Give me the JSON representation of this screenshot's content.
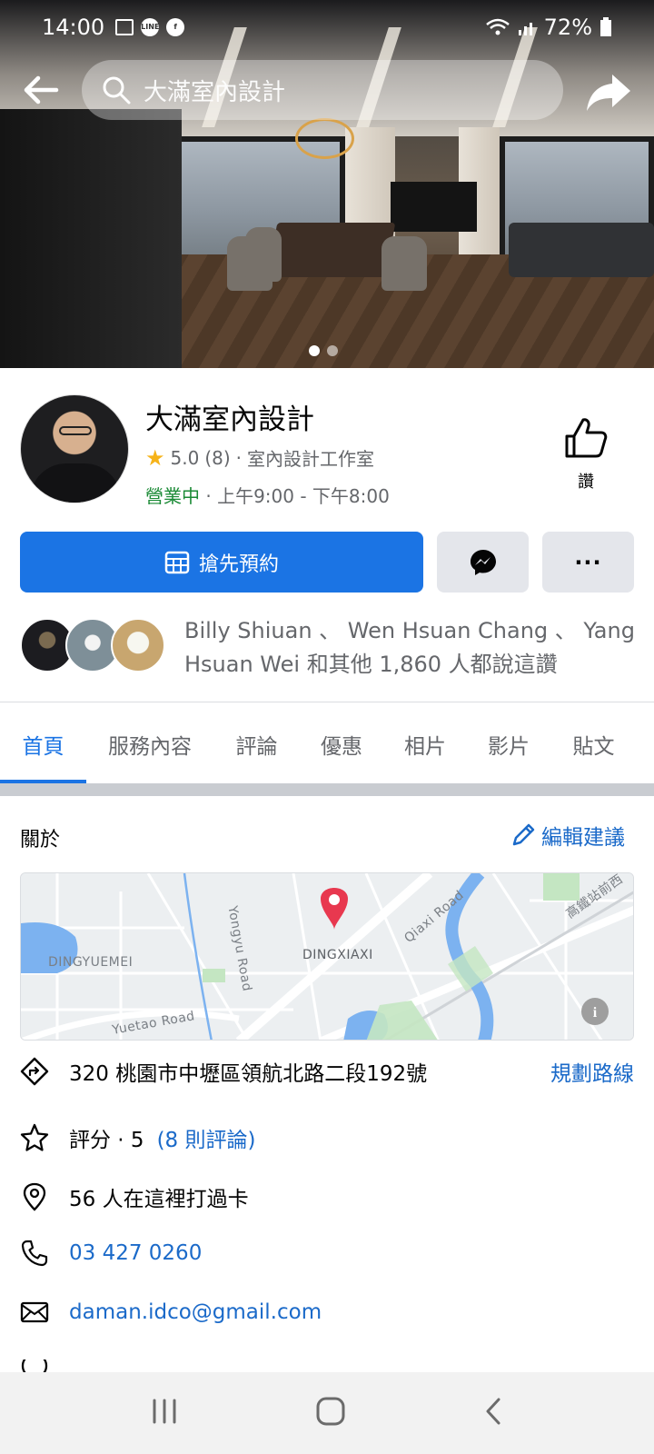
{
  "status_bar": {
    "time": "14:00",
    "battery": "72%"
  },
  "search": {
    "query": "大滿室內設計"
  },
  "page": {
    "name": "大滿室內設計",
    "rating_value": "5.0",
    "rating_count": "(8)",
    "separator": "·",
    "category": "室內設計工作室",
    "open_status": "營業中",
    "hours": "上午9:00 - 下午8:00",
    "like_label": "讚"
  },
  "actions": {
    "book_label": "搶先預約",
    "more_label": "···"
  },
  "friends_like": {
    "text": "Billy Shiuan 、 Wen Hsuan Chang 、 Yang Hsuan Wei 和其他 1,860 人都說這讚"
  },
  "tabs": [
    {
      "label": "首頁",
      "active": true
    },
    {
      "label": "服務內容",
      "active": false
    },
    {
      "label": "評論",
      "active": false
    },
    {
      "label": "優惠",
      "active": false
    },
    {
      "label": "相片",
      "active": false
    },
    {
      "label": "影片",
      "active": false
    },
    {
      "label": "貼文",
      "active": false
    }
  ],
  "about": {
    "heading": "關於",
    "edit_label": "編輯建議",
    "map_labels": {
      "center": "DINGXIAXI",
      "left": "DINGYUEMEI",
      "road1": "Yongyu Road",
      "road2": "Qiaxi Road",
      "road3": "Yuetao Road",
      "road4": "高鐵站前西"
    },
    "address": "320 桃園市中壢區領航北路二段192號",
    "directions_label": "規劃路線",
    "rating_prefix": "評分 · 5",
    "rating_reviews": "(8 則評論)",
    "checkins": "56 人在這裡打過卡",
    "phone": "03 427 0260",
    "email": "daman.idco@gmail.com"
  },
  "colors": {
    "accent": "#1b74e4",
    "link": "#1b6ac9",
    "open_green": "#1a8a35",
    "star": "#f6b319",
    "map_pin": "#e8384f",
    "water": "#7cb2f0"
  },
  "icons": {
    "back": "arrow-left-icon",
    "search": "search-icon",
    "share": "share-icon",
    "like": "thumbs-up-icon",
    "calendar": "calendar-icon",
    "messenger": "messenger-icon",
    "edit": "pencil-icon",
    "directions": "directions-icon",
    "star": "star-outline-icon",
    "checkin": "location-pin-icon",
    "phone": "phone-icon",
    "email": "envelope-icon"
  }
}
